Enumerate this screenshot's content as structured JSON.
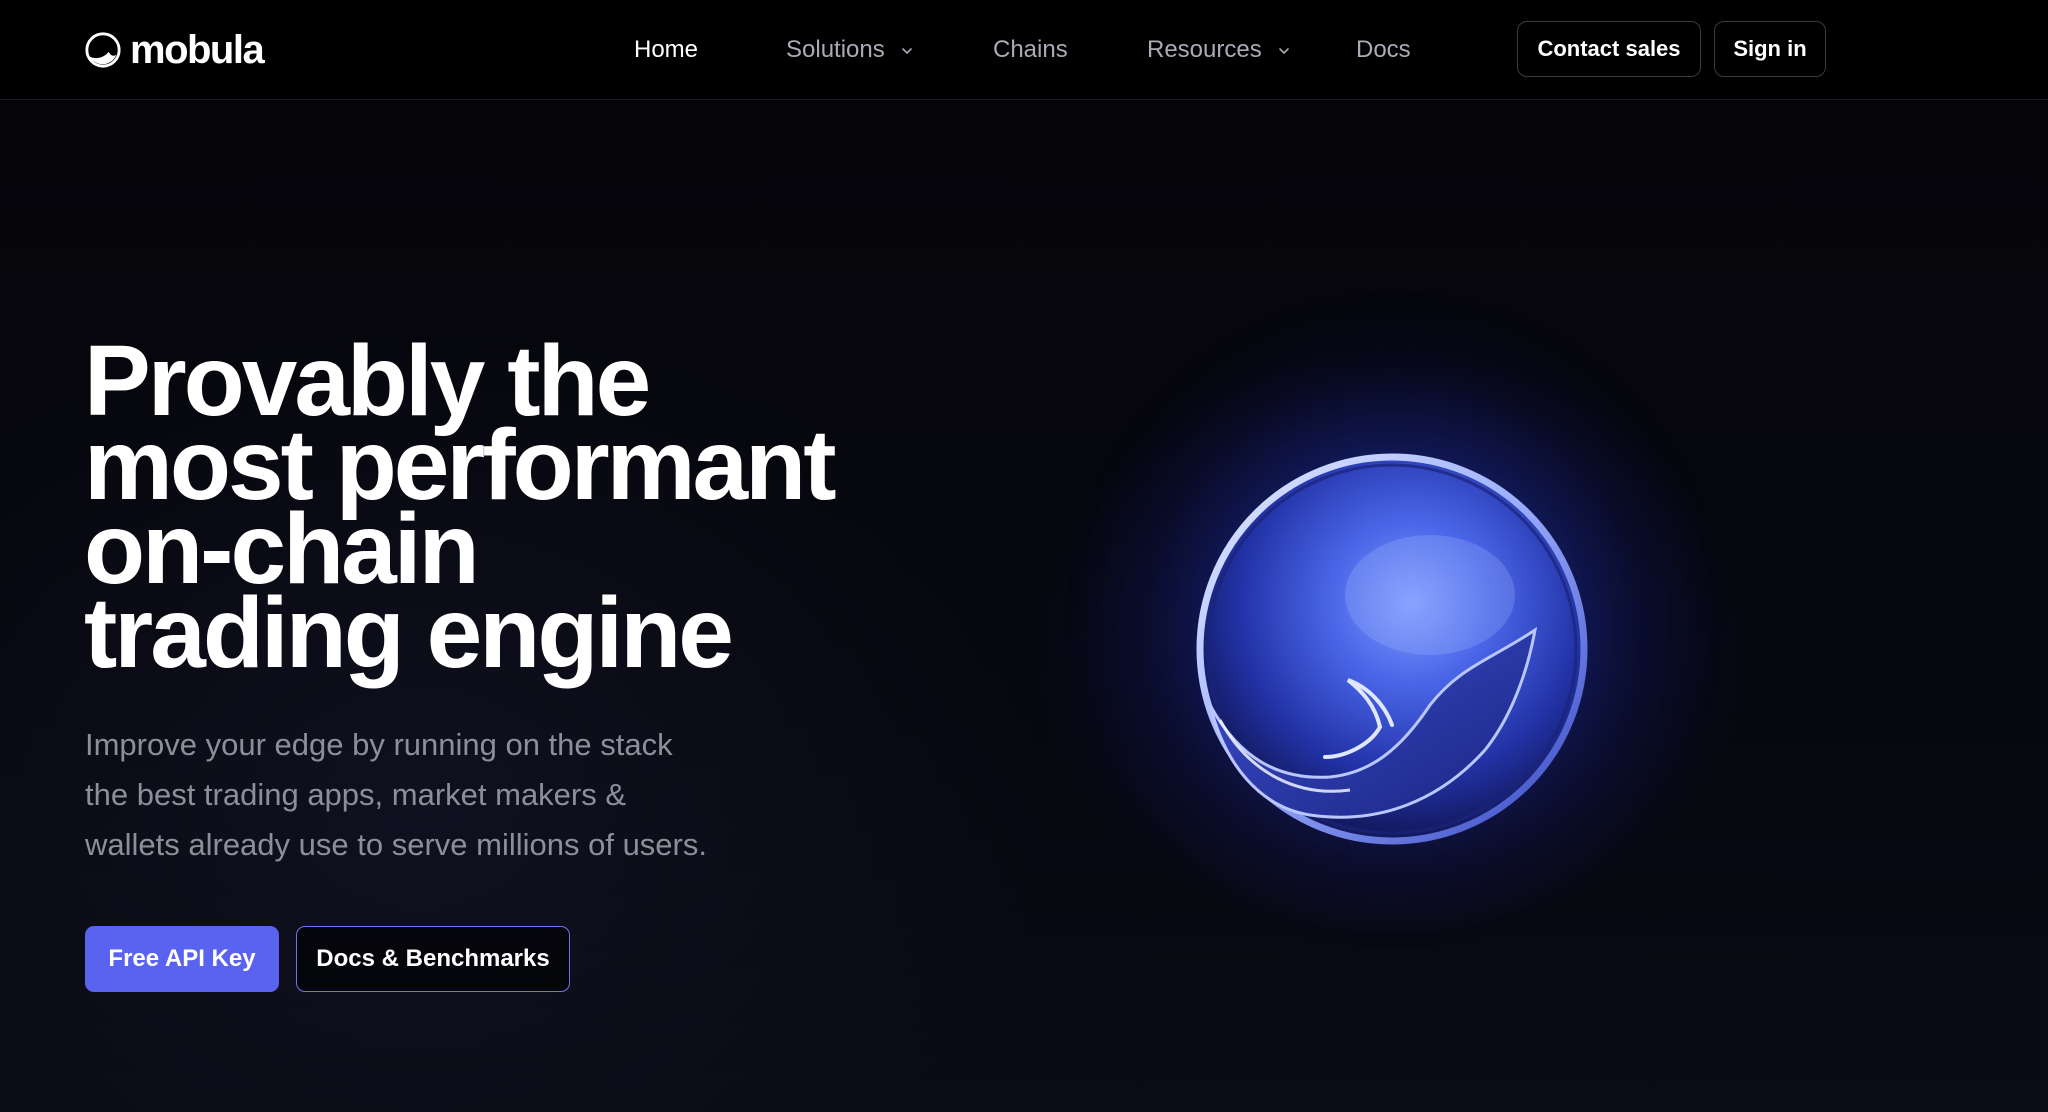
{
  "brand": {
    "name": "mobula",
    "logo_icon": "mobula-logo-icon"
  },
  "nav": {
    "items": [
      {
        "label": "Home",
        "active": true,
        "has_dropdown": false
      },
      {
        "label": "Solutions",
        "active": false,
        "has_dropdown": true
      },
      {
        "label": "Chains",
        "active": false,
        "has_dropdown": false
      },
      {
        "label": "Resources",
        "active": false,
        "has_dropdown": true
      },
      {
        "label": "Docs",
        "active": false,
        "has_dropdown": false
      }
    ],
    "contact_label": "Contact sales",
    "signin_label": "Sign in"
  },
  "hero": {
    "title_lines": [
      "Provably the",
      "most performant",
      "on-chain",
      "trading engine"
    ],
    "subtitle_lines": [
      "Improve your edge by running on the stack",
      "the best trading apps, market makers &",
      "wallets already use to serve millions of users."
    ],
    "primary_cta": "Free API Key",
    "secondary_cta": "Docs & Benchmarks",
    "illustration_icon": "manta-ray-orb-icon"
  },
  "colors": {
    "background": "#000000",
    "accent": "#5a63f0",
    "nav_text": "#a9abb5",
    "subtitle_text": "#8c8e99",
    "orb_glow": "#2e48e6"
  }
}
